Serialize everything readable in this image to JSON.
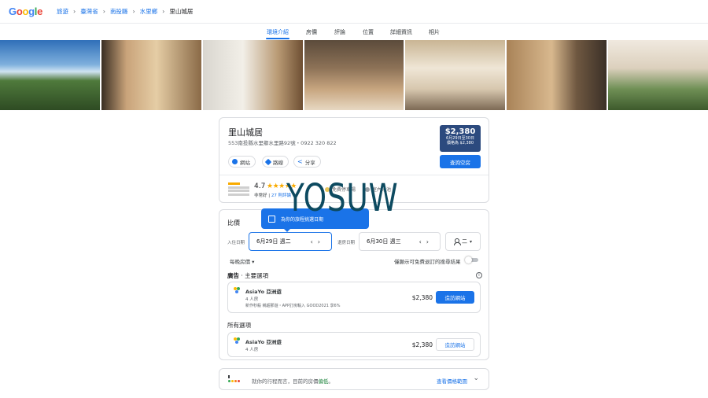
{
  "header": {
    "logo": "Google",
    "breadcrumbs": [
      "旅遊",
      "臺灣省",
      "南投縣",
      "水里鄉",
      "里山城居"
    ],
    "breadcrumb_separator": "›"
  },
  "tabs": [
    "環境介紹",
    "房價",
    "評論",
    "位置",
    "詳細資訊",
    "相片"
  ],
  "active_tab": "環境介紹",
  "hotel": {
    "name": "里山城居",
    "address": "553南投縣水里鄉水里路92號・0922 320 822",
    "actions": [
      "網站",
      "路線",
      "分享"
    ],
    "price_box": {
      "price": "$2,380",
      "line1": "6月29日至30日",
      "line2": "價格為 $2,380"
    },
    "check_availability": "查詢空房",
    "rating": {
      "score": "4.7",
      "stars": "★★★★★",
      "label": "非常好",
      "reviews": "27 則評論"
    },
    "amenities": [
      "免費停車場",
      "室內泳池"
    ]
  },
  "compare": {
    "title": "比價",
    "tooltip": "為你的旅程挑選日期",
    "checkin_label": "入住日期",
    "checkin_value": "6月29日 週二",
    "checkout_label": "退房日期",
    "checkout_value": "6月30日 週三",
    "guests": "二",
    "sort": "每晚房價 ▾",
    "toggle_label": "僅顯示可免費退訂的搜尋結果",
    "ad_label": "廣告",
    "ad_title": "主要選項",
    "info_icon": "i",
    "all_title": "所有選項",
    "offers_top": [
      {
        "name": "AsiaYo 亞洲遊",
        "sub": "4 人房",
        "promo": "新作秒殺 稱超那遊・APP訂房輸入 GOOD2021 享6%",
        "price": "$2,380",
        "visit": "造訪網站"
      }
    ],
    "offers_all": [
      {
        "name": "AsiaYo 亞洲遊",
        "sub": "4 人房",
        "price": "$2,380",
        "visit": "造訪網站"
      }
    ]
  },
  "recommendation": {
    "text_prefix": "就你的行程而言，目前的房價",
    "text_highlight": "偏低",
    "text_suffix": "。",
    "link": "查看價格範圍"
  },
  "watermark": "YOSUW",
  "colors": {
    "accent": "#1a73e8",
    "price_box": "#2c4a7e",
    "star": "#f9ab00"
  }
}
